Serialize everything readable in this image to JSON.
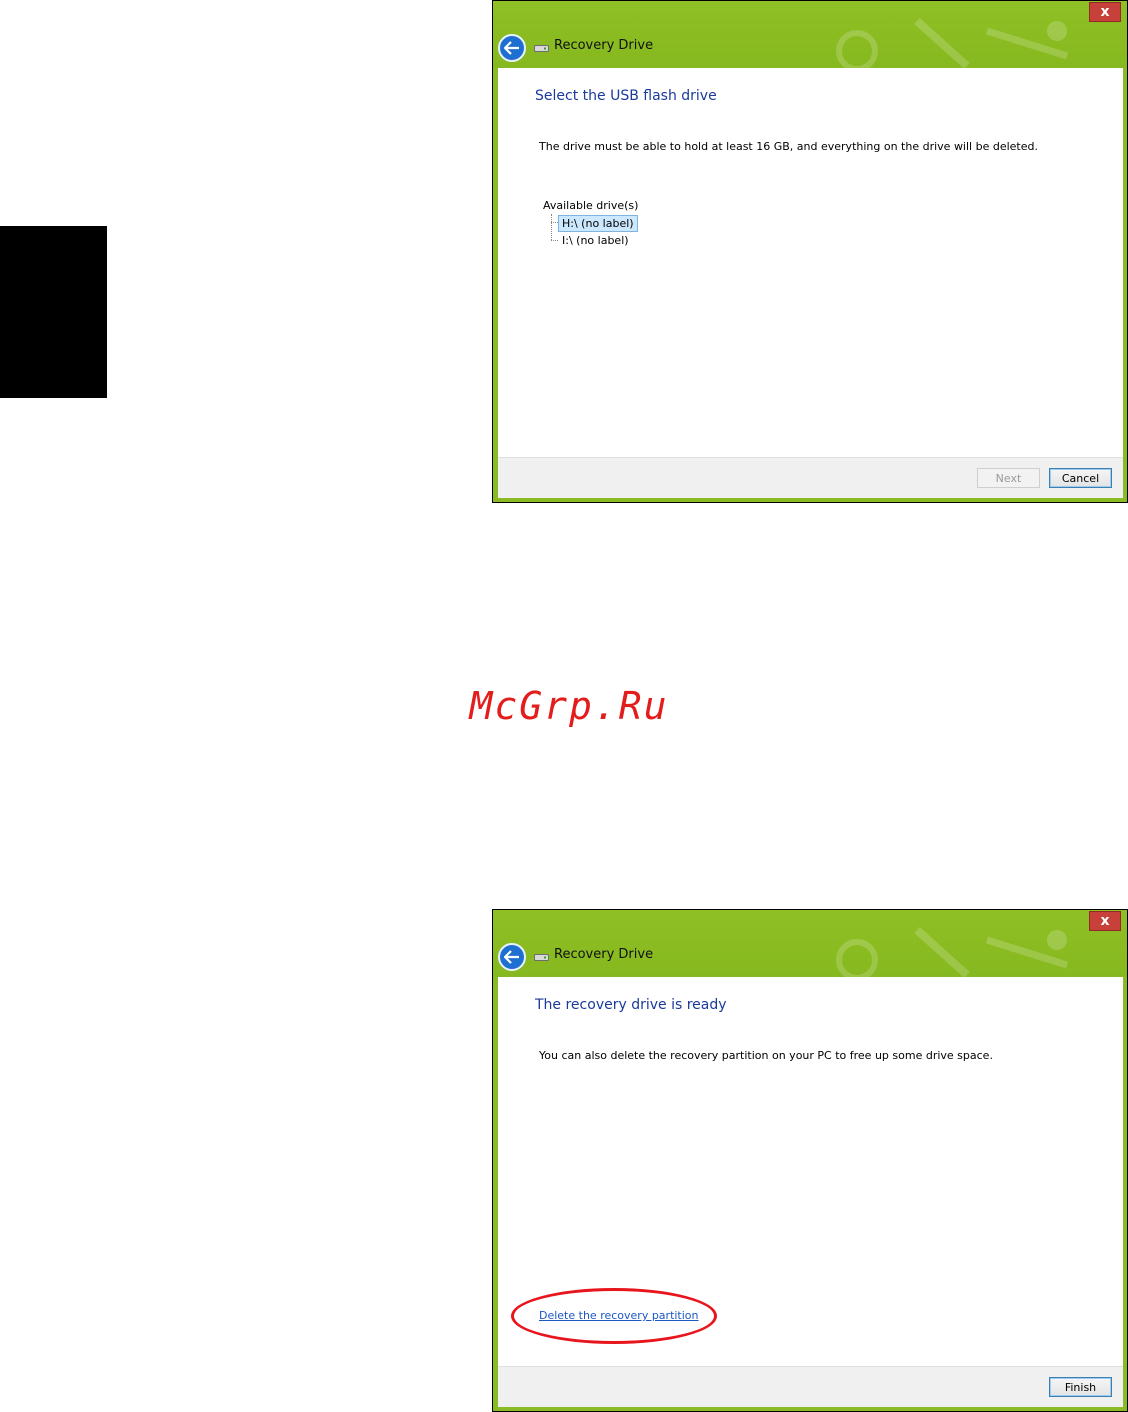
{
  "watermark": "McGrp.Ru",
  "window1": {
    "title": "Recovery Drive",
    "close_label": "x",
    "heading": "Select the USB flash drive",
    "description": "The drive must be able to hold at least 16 GB, and everything on the drive will be deleted.",
    "drives_label": "Available drive(s)",
    "drives": [
      "H:\\ (no label)",
      "I:\\ (no label)"
    ],
    "selected_drive_index": 0,
    "next_label": "Next",
    "cancel_label": "Cancel"
  },
  "window2": {
    "title": "Recovery Drive",
    "close_label": "x",
    "heading": "The recovery drive is ready",
    "description": "You can also delete the recovery partition on your PC to free up some drive space.",
    "link_label": "Delete the recovery partition",
    "finish_label": "Finish"
  },
  "colors": {
    "titlebar_green": "#8bbb24",
    "heading_blue": "#1a3a9c",
    "highlight_red": "#e8151d",
    "watermark_red": "#e31c1c"
  },
  "icons": [
    "back-arrow-icon",
    "usb-drive-icon",
    "close-icon"
  ]
}
